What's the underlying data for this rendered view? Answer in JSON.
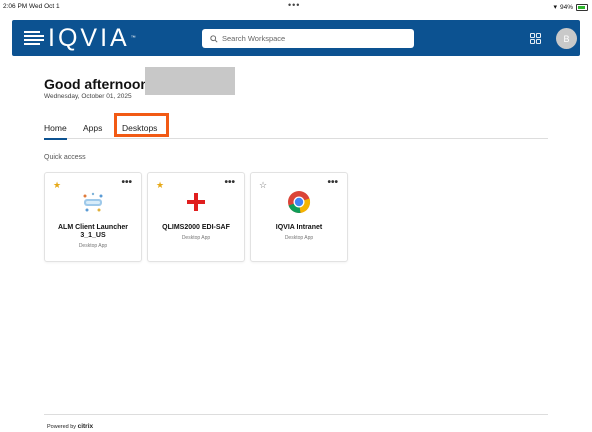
{
  "status_bar": {
    "time": "2:06 PM  Wed Oct 1",
    "dots": "•••",
    "battery": "94%"
  },
  "header": {
    "logo_text": "IQVIA",
    "logo_tm": "™",
    "search_placeholder": "Search Workspace",
    "avatar_initial": "B",
    "brand_color": "#0c5291"
  },
  "greeting": {
    "text": "Good afternoon,",
    "date": "Wednesday, October 01, 2025"
  },
  "tabs": [
    {
      "label": "Home",
      "active": true
    },
    {
      "label": "Apps",
      "active": false
    },
    {
      "label": "Desktops",
      "active": false,
      "highlighted": true
    }
  ],
  "highlight_color": "#f25a14",
  "quick_access": {
    "label": "Quick access",
    "cards": [
      {
        "name_line1": "ALM Client Launcher",
        "name_line2": "3_1_US",
        "type": "Desktop App",
        "favorite": true,
        "icon": "alm-launcher-icon"
      },
      {
        "name_line1": "QLIMS2000 EDI-SAF",
        "name_line2": "",
        "type": "Desktop App",
        "favorite": true,
        "icon": "red-plus-icon"
      },
      {
        "name_line1": "IQVIA Intranet",
        "name_line2": "",
        "type": "Desktop App",
        "favorite": false,
        "icon": "chrome-icon"
      }
    ]
  },
  "footer": {
    "powered_by": "Powered by",
    "brand": "citrix"
  }
}
